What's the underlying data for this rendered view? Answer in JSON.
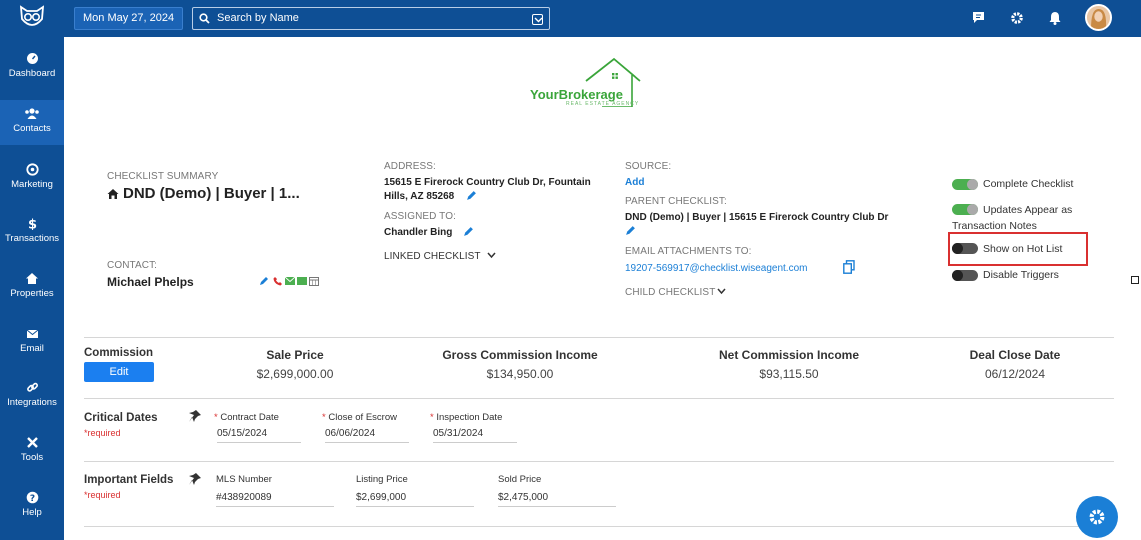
{
  "header": {
    "date": "Mon May 27, 2024",
    "search_placeholder": "Search by Name"
  },
  "sidebar": {
    "items": [
      {
        "label": "Dashboard",
        "icon": "gauge-icon"
      },
      {
        "label": "Contacts",
        "icon": "users-icon"
      },
      {
        "label": "Marketing",
        "icon": "target-icon"
      },
      {
        "label": "Transactions",
        "icon": "dollar-icon"
      },
      {
        "label": "Properties",
        "icon": "home-icon"
      },
      {
        "label": "Email",
        "icon": "envelope-icon"
      },
      {
        "label": "Integrations",
        "icon": "link-icon"
      },
      {
        "label": "Tools",
        "icon": "tools-icon"
      },
      {
        "label": "Help",
        "icon": "question-icon"
      }
    ]
  },
  "brand": {
    "name": "YourBrokerage",
    "tagline": "REAL ESTATE AGENCY"
  },
  "summary": {
    "checklist_label": "CHECKLIST SUMMARY",
    "checklist_title": "DND (Demo) | Buyer | 1...",
    "contact_label": "CONTACT:",
    "contact_name": "Michael Phelps",
    "address_label": "ADDRESS:",
    "address_line1": "15615 E Firerock Country Club Dr, Fountain",
    "address_line2": "Hills, AZ 85268",
    "assigned_label": "ASSIGNED TO:",
    "assigned_value": "Chandler Bing",
    "linked_label": "LINKED CHECKLIST",
    "source_label": "SOURCE:",
    "source_value": "Add",
    "parent_label": "PARENT CHECKLIST:",
    "parent_value": "DND (Demo) | Buyer | 15615 E Firerock Country Club Dr",
    "email_label": "EMAIL ATTACHMENTS TO:",
    "email_value": "19207-569917@checklist.wiseagent.com",
    "child_label": "CHILD CHECKLIST"
  },
  "toggles": [
    {
      "label": "Complete Checklist",
      "state": "on"
    },
    {
      "label": "Updates Appear as",
      "label2": "Transaction Notes",
      "state": "on"
    },
    {
      "label": "Show on Hot List",
      "state": "off"
    },
    {
      "label": "Disable Triggers",
      "state": "off"
    }
  ],
  "commission": {
    "title": "Commission",
    "edit_label": "Edit",
    "columns": [
      {
        "header": "Sale Price",
        "value": "$2,699,000.00"
      },
      {
        "header": "Gross Commission Income",
        "value": "$134,950.00"
      },
      {
        "header": "Net Commission Income",
        "value": "$93,115.50"
      },
      {
        "header": "Deal Close Date",
        "value": "06/12/2024"
      }
    ]
  },
  "critical_dates": {
    "title": "Critical Dates",
    "required": "*required",
    "fields": [
      {
        "label": "Contract Date",
        "value": "05/15/2024"
      },
      {
        "label": "Close of Escrow",
        "value": "06/06/2024"
      },
      {
        "label": "Inspection Date",
        "value": "05/31/2024"
      }
    ]
  },
  "important_fields": {
    "title": "Important Fields",
    "required": "*required",
    "fields": [
      {
        "label": "MLS Number",
        "value": "#438920089"
      },
      {
        "label": "Listing Price",
        "value": "$2,699,000"
      },
      {
        "label": "Sold Price",
        "value": "$2,475,000"
      }
    ]
  },
  "colors": {
    "primary": "#0e4f95",
    "accent": "#1b7fd6",
    "brand_green": "#3aa53a",
    "toggle_on": "#4caf50",
    "highlight": "#d93030"
  }
}
